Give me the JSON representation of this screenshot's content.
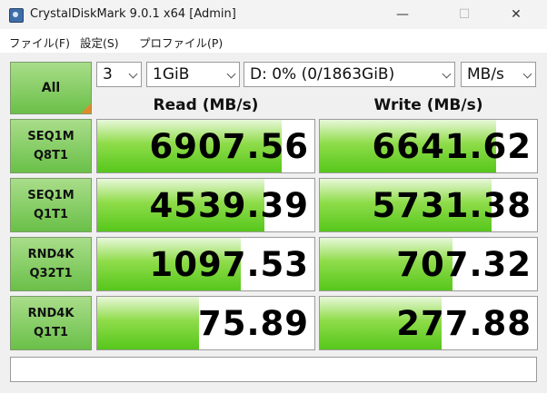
{
  "window": {
    "title": "CrystalDiskMark 9.0.1 x64 [Admin]",
    "icons": [
      "app-icon",
      "minimize-icon",
      "maximize-icon",
      "close-icon"
    ]
  },
  "menu": {
    "file": "ファイル(F)",
    "settings": "設定(S)",
    "profile": "プロファイル(P)"
  },
  "controls": {
    "all_label": "All",
    "test_count": "3",
    "test_size": "1GiB",
    "drive": "D: 0% (0/1863GiB)",
    "unit": "MB/s"
  },
  "headers": {
    "read": "Read (MB/s)",
    "write": "Write (MB/s)"
  },
  "tests": [
    {
      "line1": "SEQ1M",
      "line2": "Q8T1",
      "read": "6907.56",
      "write": "6641.62",
      "read_fill": 0.85,
      "write_fill": 0.81
    },
    {
      "line1": "SEQ1M",
      "line2": "Q1T1",
      "read": "4539.39",
      "write": "5731.38",
      "read_fill": 0.77,
      "write_fill": 0.79
    },
    {
      "line1": "RND4K",
      "line2": "Q32T1",
      "read": "1097.53",
      "write": "707.32",
      "read_fill": 0.66,
      "write_fill": 0.61
    },
    {
      "line1": "RND4K",
      "line2": "Q1T1",
      "read": "75.89",
      "write": "277.88",
      "read_fill": 0.47,
      "write_fill": 0.56
    }
  ],
  "status_text": "",
  "colors": {
    "button_green": "#6ac048",
    "bar_green": "#56c71b",
    "corner_orange": "#e08a2c"
  }
}
